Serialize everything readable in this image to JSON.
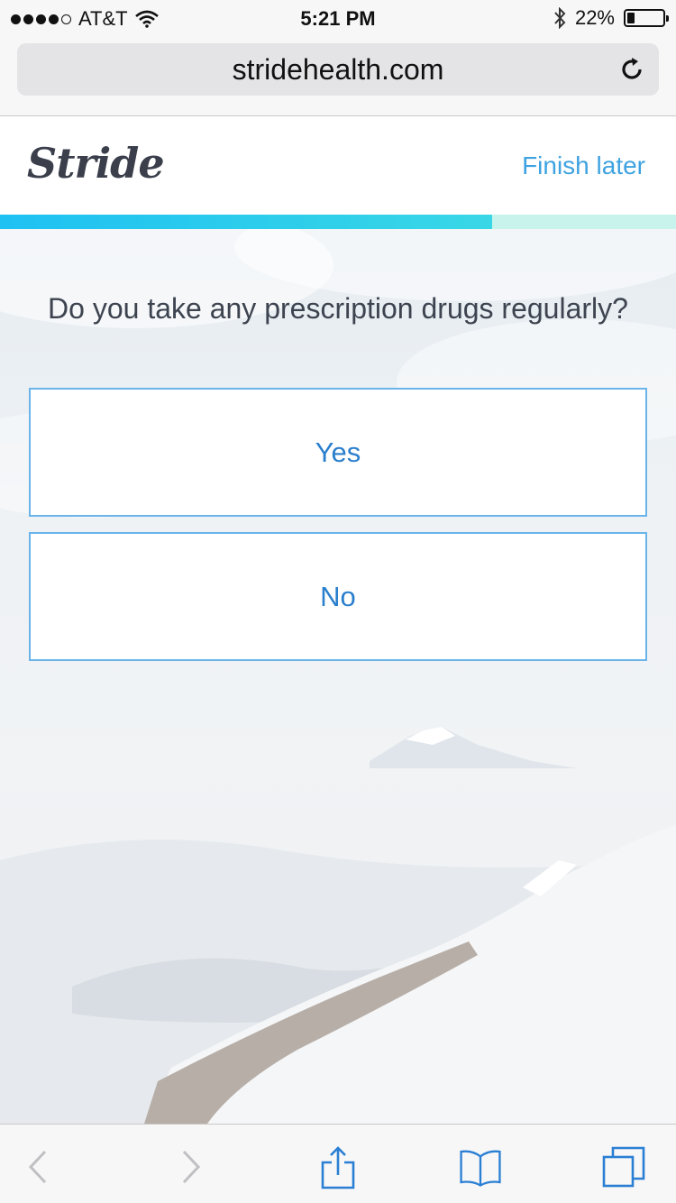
{
  "status_bar": {
    "carrier": "AT&T",
    "time": "5:21 PM",
    "battery": "22%",
    "battery_level": 0.22
  },
  "browser": {
    "url": "stridehealth.com",
    "icons": [
      "wifi-icon",
      "bluetooth-icon",
      "battery-icon",
      "reload-icon",
      "back-icon",
      "forward-icon",
      "share-icon",
      "bookmarks-icon",
      "tabs-icon"
    ]
  },
  "header": {
    "logo": "Stride",
    "finish_later": "Finish later",
    "progress": 0.728
  },
  "question": "Do you take any prescription drugs regularly?",
  "options": [
    "Yes",
    "No"
  ],
  "colors": {
    "accent": "#3ea3e0",
    "option_text": "#2a7fcc",
    "option_border": "#6ab4ea",
    "progress_fill": "#1ec1f2",
    "progress_track": "#c7f3ec"
  }
}
